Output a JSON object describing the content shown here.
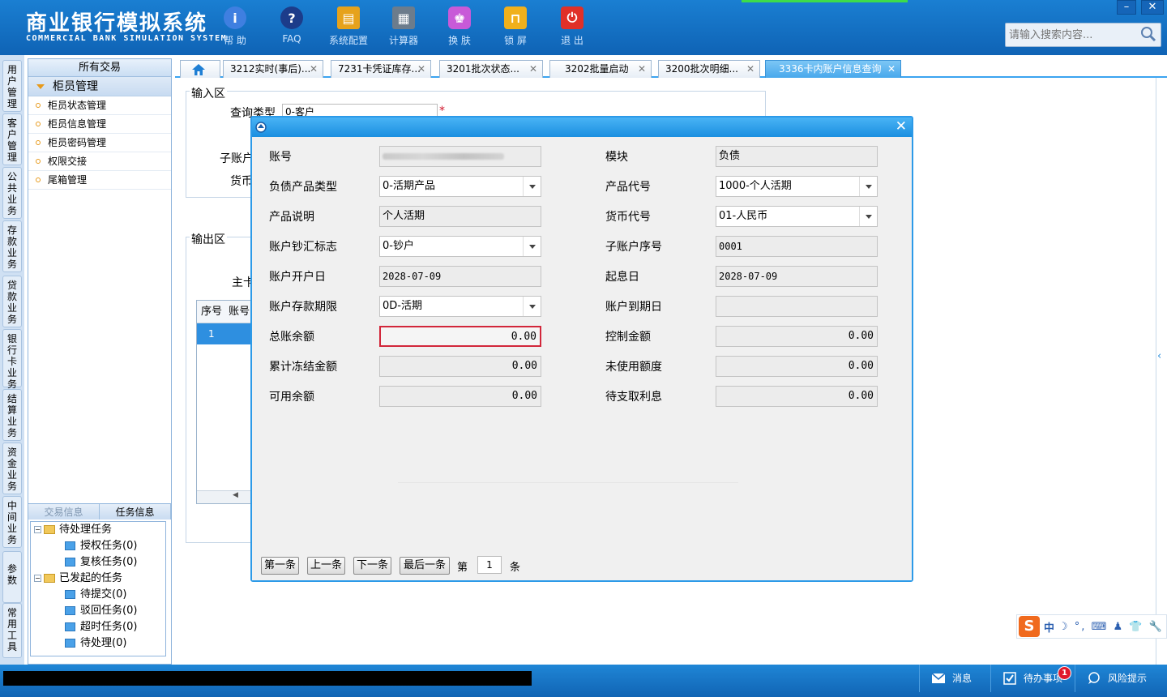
{
  "app": {
    "title_cn": "商业银行模拟系统",
    "title_en": "COMMERCIAL BANK SIMULATION SYSTEM"
  },
  "toolbar": [
    {
      "label": "帮 助",
      "icon": "info-icon",
      "color": "#3f7fe0"
    },
    {
      "label": "FAQ",
      "icon": "question-icon",
      "color": "#1c3c8a"
    },
    {
      "label": "系统配置",
      "icon": "toolbox-icon",
      "color": "#e6a21c"
    },
    {
      "label": "计算器",
      "icon": "calculator-icon",
      "color": "#6c7c8c"
    },
    {
      "label": "换 肤",
      "icon": "shirt-icon",
      "color": "#c85ad8"
    },
    {
      "label": "锁 屏",
      "icon": "lock-icon",
      "color": "#f0b01c"
    },
    {
      "label": "退 出",
      "icon": "power-icon",
      "color": "#e03028"
    }
  ],
  "window_controls": {
    "minimize": "–",
    "close": "✕"
  },
  "search": {
    "placeholder": "请输入搜索内容..."
  },
  "vertical_tabs": [
    "用户管理",
    "客户管理",
    "公共业务",
    "存款业务",
    "贷款业务",
    "银行卡业务",
    "结算业务",
    "资金业务",
    "中间业务",
    "参数",
    "常用工具"
  ],
  "left_panel": {
    "header": "所有交易",
    "group": "柜员管理",
    "items": [
      "柜员状态管理",
      "柜员信息管理",
      "柜员密码管理",
      "权限交接",
      "尾箱管理"
    ],
    "task_tabs": [
      "交易信息",
      "任务信息"
    ],
    "tree": {
      "pending": "待处理任务",
      "auth": "授权任务(0)",
      "review": "复核任务(0)",
      "initiated": "已发起的任务",
      "to_submit": "待提交(0)",
      "rejected": "驳回任务(0)",
      "timeout": "超时任务(0)",
      "processing": "待处理(0)"
    }
  },
  "tabs": [
    {
      "label": "3212实时(事后)..."
    },
    {
      "label": "7231卡凭证库存..."
    },
    {
      "label": "3201批次状态..."
    },
    {
      "label": "3202批量启动"
    },
    {
      "label": "3200批次明细..."
    },
    {
      "label": "3336卡内账户信息查询"
    }
  ],
  "background_form": {
    "input_area": "输入区",
    "query_type_label": "查询类型",
    "query_type_value": "0-客户",
    "required_mark": "*",
    "sub_account_label": "子账户",
    "currency_label": "货币",
    "output_area": "输出区",
    "main_label": "主卡",
    "col_seq": "序号",
    "col_account": "账号",
    "row1_seq": "1"
  },
  "modal": {
    "close": "✕",
    "left": [
      {
        "label": "账号",
        "value": "",
        "type": "blurred"
      },
      {
        "label": "负债产品类型",
        "value": "0-活期产品",
        "type": "select"
      },
      {
        "label": "产品说明",
        "value": "个人活期",
        "type": "text"
      },
      {
        "label": "账户钞汇标志",
        "value": "0-钞户",
        "type": "select"
      },
      {
        "label": "账户开户日",
        "value": "2028-07-09",
        "type": "text"
      },
      {
        "label": "账户存款期限",
        "value": "0D-活期",
        "type": "select"
      },
      {
        "label": "总账余额",
        "value": "0.00",
        "type": "num-red"
      },
      {
        "label": "累计冻结金额",
        "value": "0.00",
        "type": "num"
      },
      {
        "label": "可用余额",
        "value": "0.00",
        "type": "num"
      }
    ],
    "right": [
      {
        "label": "模块",
        "value": "负债",
        "type": "text"
      },
      {
        "label": "产品代号",
        "value": "1000-个人活期",
        "type": "select"
      },
      {
        "label": "货币代号",
        "value": "01-人民币",
        "type": "select"
      },
      {
        "label": "子账户序号",
        "value": "0001",
        "type": "text"
      },
      {
        "label": "起息日",
        "value": "2028-07-09",
        "type": "text"
      },
      {
        "label": "账户到期日",
        "value": "",
        "type": "text"
      },
      {
        "label": "控制金额",
        "value": "0.00",
        "type": "num"
      },
      {
        "label": "未使用额度",
        "value": "0.00",
        "type": "num"
      },
      {
        "label": "待支取利息",
        "value": "0.00",
        "type": "num"
      }
    ],
    "nav": {
      "first": "第一条",
      "prev": "上一条",
      "next": "下一条",
      "last": "最后一条",
      "page_prefix": "第",
      "page_value": "1",
      "page_suffix": "条"
    }
  },
  "ime": {
    "logo": "S",
    "mode": "中",
    "icons": "☽ °, ⌨ ♟ 👕 🔧"
  },
  "status": {
    "message": "消息",
    "todo": "待办事项",
    "todo_count": "1",
    "risk": "风险提示"
  }
}
